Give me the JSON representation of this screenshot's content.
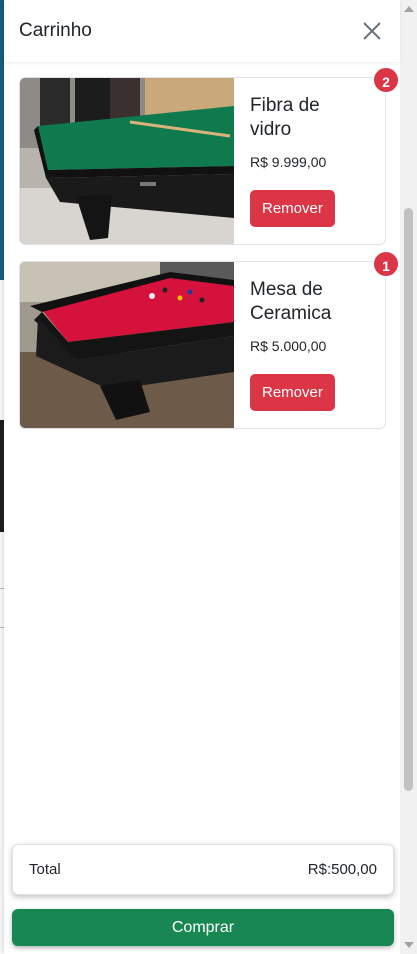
{
  "title": "Carrinho",
  "icons": {
    "close": "close-icon"
  },
  "items": [
    {
      "name": "Fibra de vidro",
      "price": "R$ 9.999,00",
      "remove_label": "Remover",
      "quantity": "2",
      "felt_color": "#0f7a4e"
    },
    {
      "name": "Mesa de Ceramica",
      "price": "R$ 5.000,00",
      "remove_label": "Remover",
      "quantity": "1",
      "felt_color": "#d5123c"
    }
  ],
  "total": {
    "label": "Total",
    "value": "R$:500,00"
  },
  "buy_label": "Comprar",
  "colors": {
    "danger": "#dc3545",
    "success": "#198754"
  }
}
